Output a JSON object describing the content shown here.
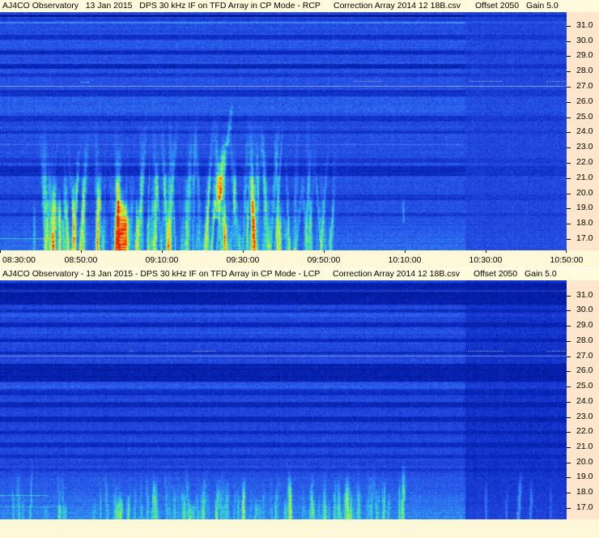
{
  "colors": {
    "header_bg": "#FFFBDC",
    "axis_bg": "#FDE6CB",
    "strip_bg": "#FFF8D8"
  },
  "chart_data": [
    {
      "type": "heatmap",
      "title": "AJ4CO Observatory   13 Jan 2015   DPS 30 kHz IF on TFD Array in CP Mode - RCP",
      "correction_file": "Correction Array 2014 12 18B.csv",
      "offset": "Offset 2050",
      "gain": "Gain 5.0",
      "x_ticks": [
        "08:30:00",
        "08:50:00",
        "09:10:00",
        "09:30:00",
        "09:50:00",
        "10:10:00",
        "10:30:00",
        "10:50:00"
      ],
      "y_ticks": [
        "31.0",
        "30.0",
        "29.0",
        "28.0",
        "27.0",
        "26.0",
        "25.0",
        "24.0",
        "23.0",
        "22.0",
        "21.0",
        "20.0",
        "19.0",
        "18.0",
        "17.0"
      ],
      "ylim": [
        16.25,
        31.9
      ]
    },
    {
      "type": "heatmap",
      "title": "AJ4CO Observatory - 13 Jan 2015 - DPS 30 kHz IF on TFD Array in CP Mode - LCP",
      "correction_file": "Correction Array 2014 12 18B.csv",
      "offset": "Offset 2050",
      "gain": "Gain 5.0",
      "y_ticks": [
        "31.0",
        "30.0",
        "29.0",
        "28.0",
        "27.0",
        "26.0",
        "25.0",
        "24.0",
        "23.0",
        "22.0",
        "21.0",
        "20.0",
        "19.0",
        "18.0",
        "17.0"
      ],
      "ylim": [
        16.25,
        32.0
      ]
    }
  ]
}
